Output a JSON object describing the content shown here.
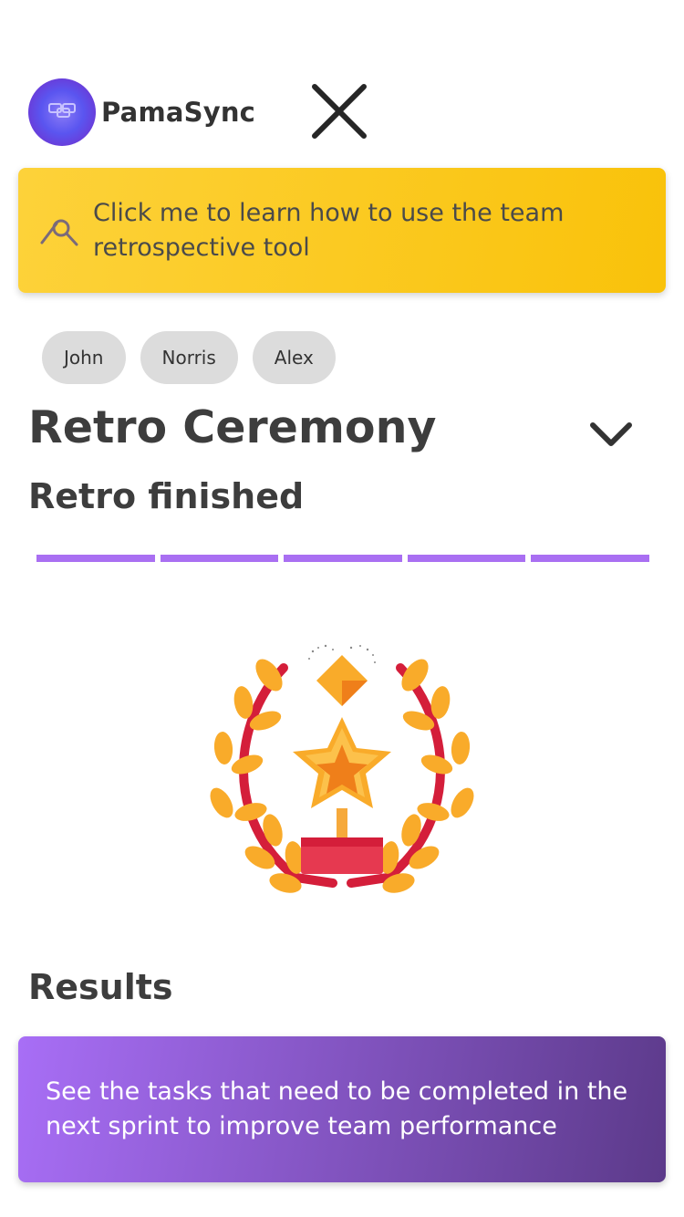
{
  "app": {
    "name": "PamaSync"
  },
  "tutorial_banner": {
    "text": "Click me to learn how to use the team retrospective tool"
  },
  "participants": [
    "John",
    "Norris",
    "Alex"
  ],
  "ceremony": {
    "title": "Retro Ceremony",
    "status": "Retro finished",
    "progress": {
      "completed_steps": 5,
      "total_steps": 5
    }
  },
  "results": {
    "heading": "Results",
    "card_text": "See the tasks that need to be completed in the next sprint to improve team performance"
  },
  "colors": {
    "banner_gradient": [
      "#fdd23a",
      "#f9c20a"
    ],
    "results_gradient": [
      "#a86ef6",
      "#5c3a8a"
    ],
    "progress": "#a96ff2",
    "chip_bg": "#dcdcdc"
  },
  "icons": {
    "logo": "pamasync-logo-icon",
    "close": "close-icon",
    "tutorial": "tutorial-pointer-icon",
    "expand": "chevron-down-icon",
    "illustration": "trophy-laurel-illustration"
  }
}
